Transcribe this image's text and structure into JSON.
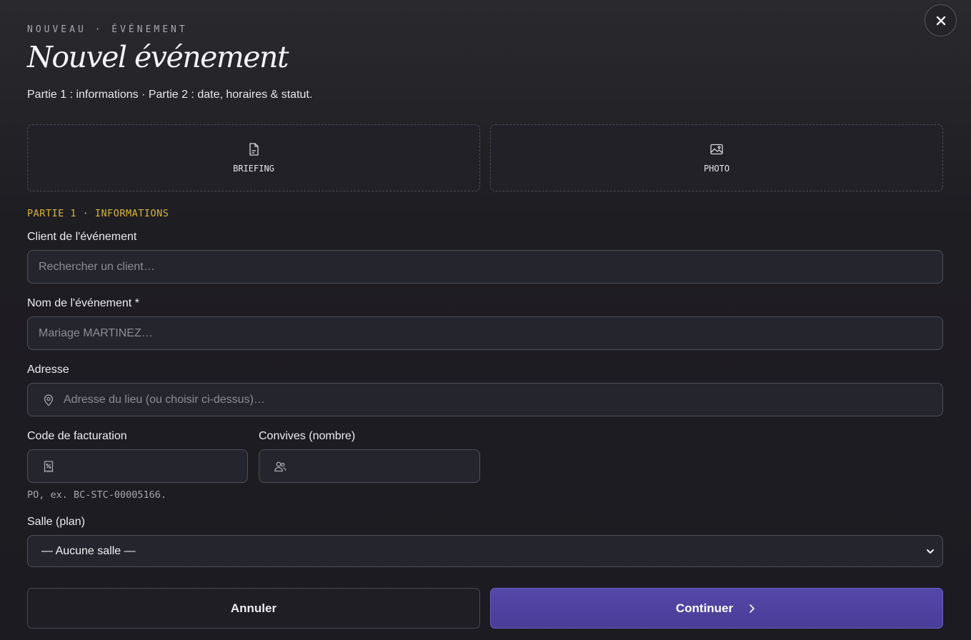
{
  "header": {
    "eyebrow": "NOUVEAU · ÉVÉNEMENT",
    "title": "Nouvel événement",
    "subtitle": "Partie 1 : informations · Partie 2 : date, horaires & statut."
  },
  "uploads": [
    {
      "label": "BRIEFING",
      "icon": "document-icon"
    },
    {
      "label": "PHOTO",
      "icon": "image-icon"
    }
  ],
  "section_title": "PARTIE 1 · INFORMATIONS",
  "fields": {
    "client": {
      "label": "Client de l'événement",
      "placeholder": "Rechercher un client…",
      "value": ""
    },
    "name": {
      "label": "Nom de l'événement *",
      "placeholder": "Mariage MARTINEZ…",
      "value": ""
    },
    "address": {
      "label": "Adresse",
      "placeholder": "Adresse du lieu (ou choisir ci-dessus)…",
      "value": ""
    },
    "billing_code": {
      "label": "Code de facturation",
      "placeholder": "",
      "value": "",
      "hint": "PO, ex. BC-STC-00005166."
    },
    "guests": {
      "label": "Convives (nombre)",
      "placeholder": "",
      "value": ""
    },
    "room": {
      "label": "Salle (plan)",
      "selected": "— Aucune salle —"
    }
  },
  "actions": {
    "cancel": "Annuler",
    "continue": "Continuer"
  },
  "colors": {
    "accent": "#5447a8",
    "section": "#d8b43a"
  }
}
